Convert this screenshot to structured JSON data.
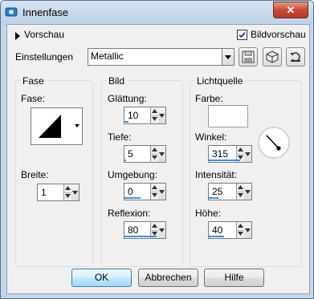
{
  "window": {
    "title": "Innenfase",
    "close_symbol": "✕"
  },
  "header": {
    "preview_label": "Vorschau",
    "image_preview_label": "Bildvorschau",
    "image_preview_checked": true,
    "settings_label": "Einstellungen",
    "settings_value": "Metallic"
  },
  "groups": {
    "fase": {
      "title": "Fase",
      "shape_label": "Fase:",
      "width_label": "Breite:",
      "width_value": "1"
    },
    "bild": {
      "title": "Bild",
      "smoothing_label": "Glättung:",
      "smoothing_value": "10",
      "depth_label": "Tiefe:",
      "depth_value": "5",
      "ambience_label": "Umgebung:",
      "ambience_value": "0",
      "reflection_label": "Reflexion:",
      "reflection_value": "80"
    },
    "licht": {
      "title": "Lichtquelle",
      "color_label": "Farbe:",
      "color_value": "#ffffff",
      "angle_label": "Winkel:",
      "angle_value": "315",
      "intensity_label": "Intensität:",
      "intensity_value": "25",
      "height_label": "Höhe:",
      "height_value": "40"
    }
  },
  "footer": {
    "ok_label": "OK",
    "cancel_label": "Abbrechen",
    "help_label": "Hilfe"
  },
  "colors": {
    "accent": "#3c8fe0",
    "title_bar": "#c4d5ea",
    "close_button": "#c74a33"
  }
}
